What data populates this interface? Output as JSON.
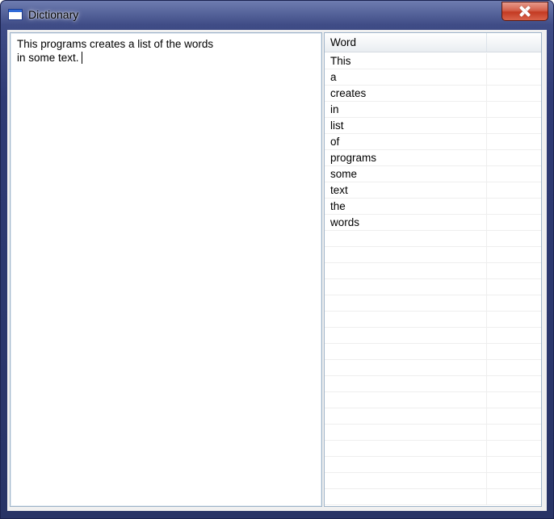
{
  "window": {
    "title": "Dictionary"
  },
  "editor": {
    "lines": [
      "This programs creates a list of the words",
      "in some text."
    ]
  },
  "table": {
    "columns": [
      "Word",
      ""
    ],
    "rows": [
      "This",
      "a",
      "creates",
      "in",
      "list",
      "of",
      "programs",
      "some",
      "text",
      "the",
      "words"
    ],
    "empty_row_count": 17
  },
  "icons": {
    "app": "window-icon",
    "close": "close-icon"
  },
  "colors": {
    "titlebar": "#3f4c86",
    "close_button": "#c33a22",
    "border": "#9fb4c9"
  }
}
